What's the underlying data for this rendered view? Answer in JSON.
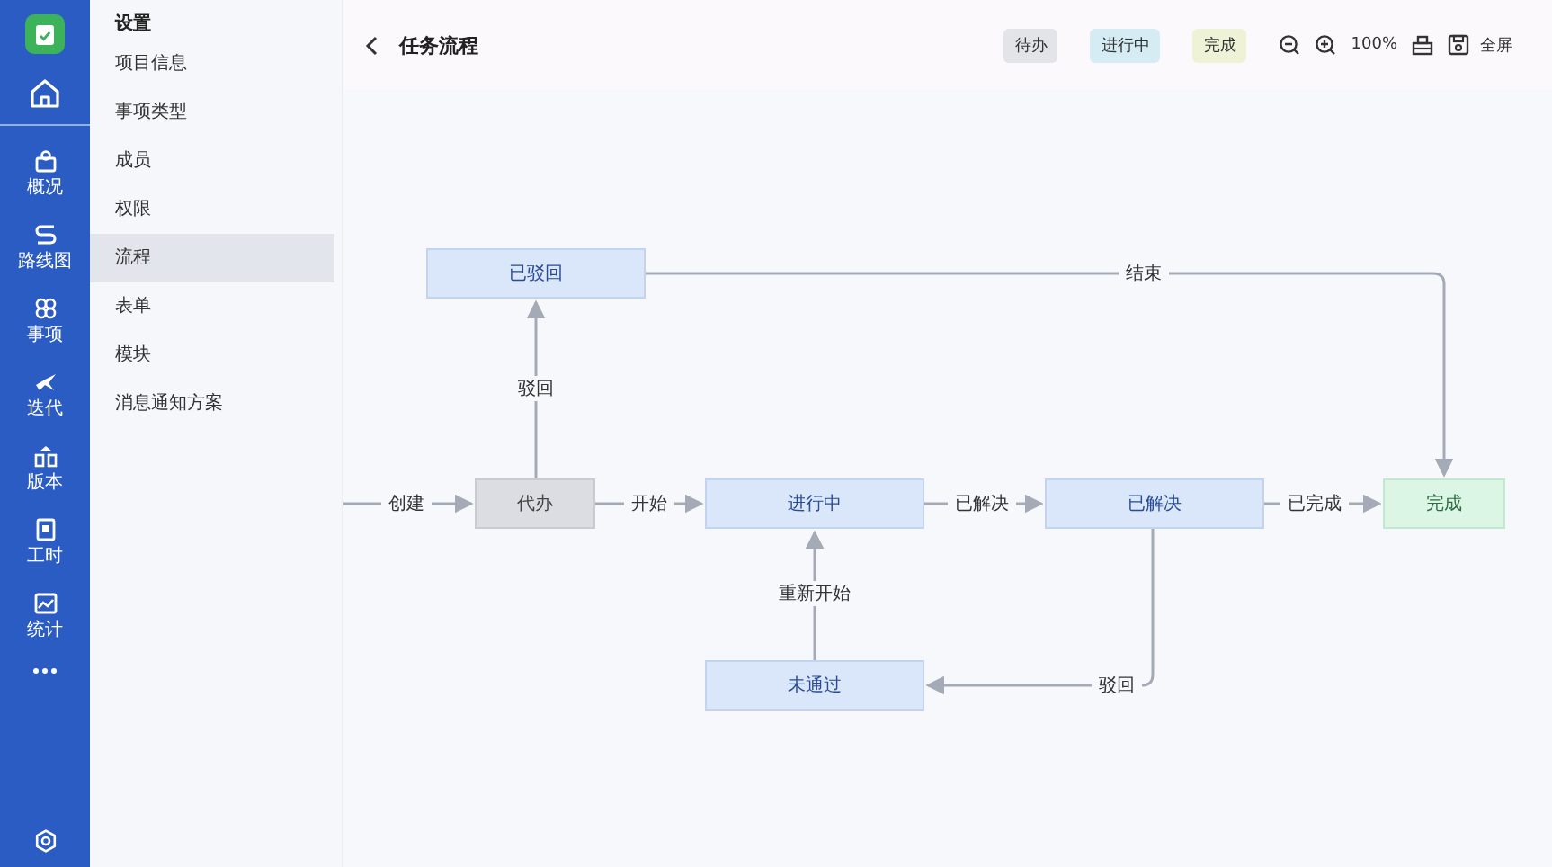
{
  "rail": {
    "items": [
      {
        "label": "概况",
        "selected": false
      },
      {
        "label": "路线图",
        "selected": false
      },
      {
        "label": "事项",
        "selected": false
      },
      {
        "label": "迭代",
        "selected": false
      },
      {
        "label": "版本",
        "selected": false
      },
      {
        "label": "工时",
        "selected": false
      },
      {
        "label": "统计",
        "selected": false
      }
    ]
  },
  "settings_menu": {
    "title": "设置",
    "items": [
      {
        "label": "项目信息",
        "selected": false
      },
      {
        "label": "事项类型",
        "selected": false
      },
      {
        "label": "成员",
        "selected": false
      },
      {
        "label": "权限",
        "selected": false
      },
      {
        "label": "流程",
        "selected": true
      },
      {
        "label": "表单",
        "selected": false
      },
      {
        "label": "模块",
        "selected": false
      },
      {
        "label": "消息通知方案",
        "selected": false
      }
    ]
  },
  "toolbar": {
    "title": "任务流程",
    "legend": [
      {
        "label": "待办",
        "kind": "todo"
      },
      {
        "label": "进行中",
        "kind": "doing"
      },
      {
        "label": "完成",
        "kind": "done"
      }
    ],
    "zoom": "100%",
    "fullscreen": "全屏"
  },
  "workflow": {
    "nodes": [
      {
        "label": "已驳回",
        "kind": "doing"
      },
      {
        "label": "代办",
        "kind": "todo"
      },
      {
        "label": "进行中",
        "kind": "doing"
      },
      {
        "label": "已解决",
        "kind": "doing"
      },
      {
        "label": "完成",
        "kind": "done"
      },
      {
        "label": "未通过",
        "kind": "doing"
      }
    ],
    "transitions": [
      {
        "label": "创建"
      },
      {
        "label": "开始"
      },
      {
        "label": "已解决"
      },
      {
        "label": "已完成"
      },
      {
        "label": "驳回"
      },
      {
        "label": "结束"
      },
      {
        "label": "驳回"
      },
      {
        "label": "重新开始"
      }
    ]
  }
}
